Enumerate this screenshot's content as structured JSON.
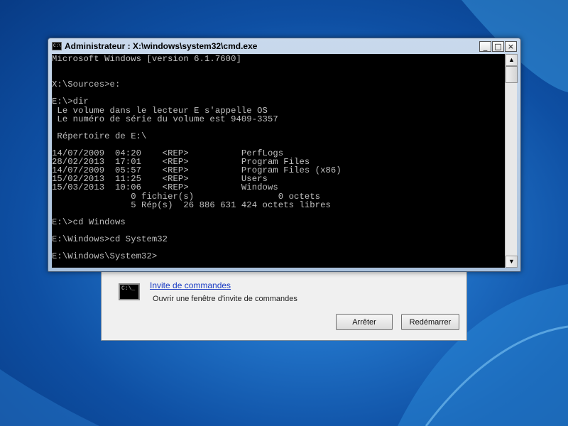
{
  "cmd_window": {
    "title": "Administrateur : X:\\windows\\system32\\cmd.exe",
    "icon": "console-icon",
    "controls": {
      "minimize": "_",
      "maximize": "□",
      "close": "×"
    },
    "output_lines": [
      "Microsoft Windows [version 6.1.7600]",
      "",
      "",
      "X:\\Sources>e:",
      "",
      "E:\\>dir",
      " Le volume dans le lecteur E s'appelle OS",
      " Le numéro de série du volume est 9409-3357",
      "",
      " Répertoire de E:\\",
      "",
      "14/07/2009  04:20    <REP>          PerfLogs",
      "28/02/2013  17:01    <REP>          Program Files",
      "14/07/2009  05:57    <REP>          Program Files (x86)",
      "15/02/2013  11:25    <REP>          Users",
      "15/03/2013  10:06    <REP>          Windows",
      "               0 fichier(s)                0 octets",
      "               5 Rép(s)  26 886 631 424 octets libres",
      "",
      "E:\\>cd Windows",
      "",
      "E:\\Windows>cd System32",
      "",
      "E:\\Windows\\System32>"
    ],
    "scrollbar": {
      "up_arrow": "▲",
      "down_arrow": "▼"
    }
  },
  "recovery_panel": {
    "icon_text": "C:\\_",
    "link": "Invite de commandes",
    "description": "Ouvrir une fenêtre d'invite de commandes",
    "buttons": {
      "stop": "Arrêter",
      "restart": "Redémarrer"
    }
  },
  "colors": {
    "console_background": "#000000",
    "console_text": "#c0c0c0",
    "link": "#1a3cc4",
    "desktop": "#1f6fc4"
  }
}
